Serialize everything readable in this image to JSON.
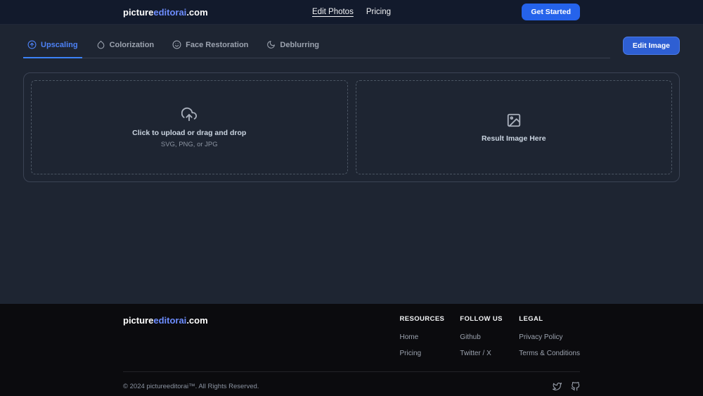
{
  "header": {
    "logo": {
      "part1": "picture",
      "part2": "editorai",
      "part3": ".com"
    },
    "nav": [
      {
        "label": "Edit Photos",
        "active": true
      },
      {
        "label": "Pricing",
        "active": false
      }
    ],
    "cta_label": "Get Started"
  },
  "tabs": [
    {
      "label": "Upscaling",
      "active": true
    },
    {
      "label": "Colorization",
      "active": false
    },
    {
      "label": "Face Restoration",
      "active": false
    },
    {
      "label": "Deblurring",
      "active": false
    }
  ],
  "toolbar": {
    "edit_image_label": "Edit Image"
  },
  "upload_panel": {
    "title": "Click to upload or drag and drop",
    "subtitle": "SVG, PNG, or JPG"
  },
  "result_panel": {
    "label": "Result Image Here"
  },
  "footer": {
    "logo": {
      "part1": "picture",
      "part2": "editorai",
      "part3": ".com"
    },
    "columns": [
      {
        "title": "RESOURCES",
        "links": [
          "Home",
          "Pricing"
        ]
      },
      {
        "title": "FOLLOW US",
        "links": [
          "Github",
          "Twitter / X"
        ]
      },
      {
        "title": "LEGAL",
        "links": [
          "Privacy Policy",
          "Terms & Conditions"
        ]
      }
    ],
    "copyright": "© 2024 pictureeditorai™. All Rights Reserved."
  },
  "icons": {
    "upscaling": "arrow-up-circle-icon",
    "colorization": "droplet-icon",
    "face_restoration": "smile-icon",
    "deblurring": "moon-icon",
    "upload": "upload-cloud-icon",
    "result": "image-icon",
    "social": [
      "twitter-icon",
      "github-icon"
    ]
  },
  "colors": {
    "accent": "#2563eb",
    "accent_light": "#4d82f7",
    "header_bg": "#121a2c",
    "main_bg": "#1e2532",
    "footer_bg": "#0b0b0e"
  }
}
